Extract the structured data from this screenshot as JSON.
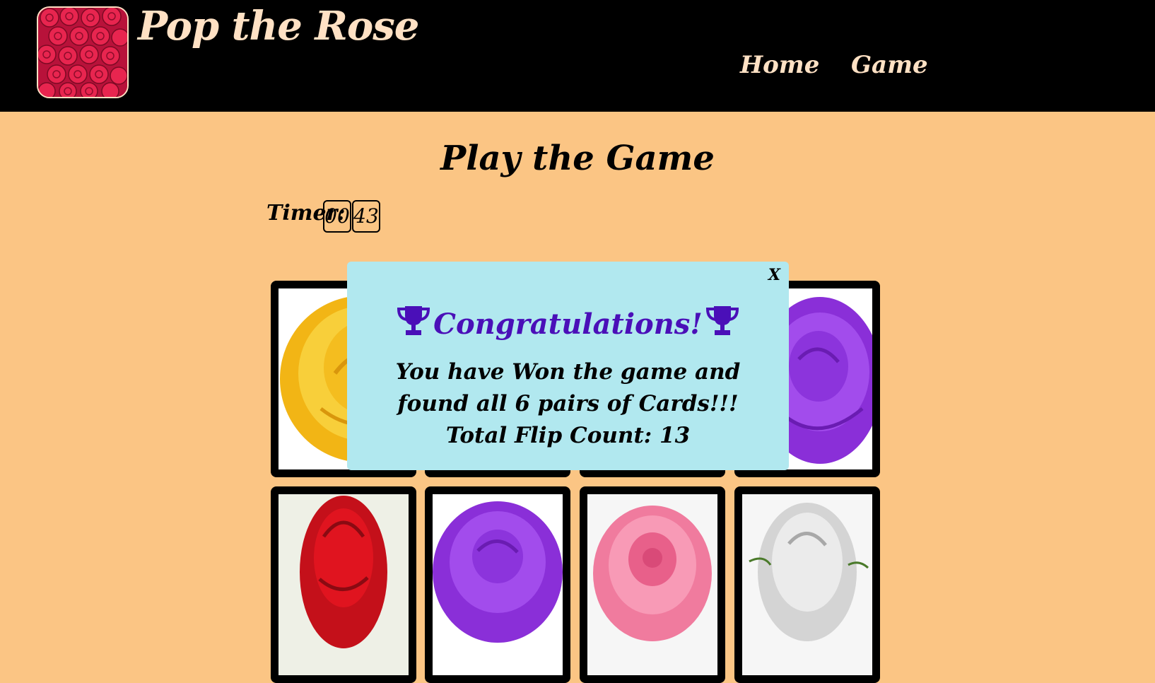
{
  "header": {
    "title": "Pop the Rose",
    "logo_icon": "rose-bouquet-icon",
    "nav": [
      {
        "label": "Home"
      },
      {
        "label": "Game"
      }
    ]
  },
  "main": {
    "heading": "Play the Game",
    "timer": {
      "label": "Timer:",
      "minutes": "00",
      "seconds": "43"
    },
    "cards": [
      {
        "rose": "yellow-rose-icon",
        "color": "#f6c21c"
      },
      {
        "rose": "hidden",
        "color": "#ffffff"
      },
      {
        "rose": "hidden",
        "color": "#ffffff"
      },
      {
        "rose": "purple-rose-icon",
        "color": "#9d3ee6"
      },
      {
        "rose": "red-rose-icon",
        "color": "#c4101a"
      },
      {
        "rose": "purple-rose-icon",
        "color": "#9d3ee6"
      },
      {
        "rose": "pink-rose-icon",
        "color": "#f07b9e"
      },
      {
        "rose": "white-rose-icon",
        "color": "#d4d4d4"
      }
    ]
  },
  "modal": {
    "close_label": "X",
    "trophy_icon": "trophy-icon",
    "title": "Congratulations!",
    "message": "You have Won the game and found all 6 pairs of Cards!!!",
    "flip_count": "Total Flip Count: 13",
    "title_color": "#4a0fb8",
    "background": "#b1e8ef"
  },
  "colors": {
    "header_bg": "#000000",
    "header_text": "#ffe1c4",
    "page_bg": "#fbc584"
  }
}
